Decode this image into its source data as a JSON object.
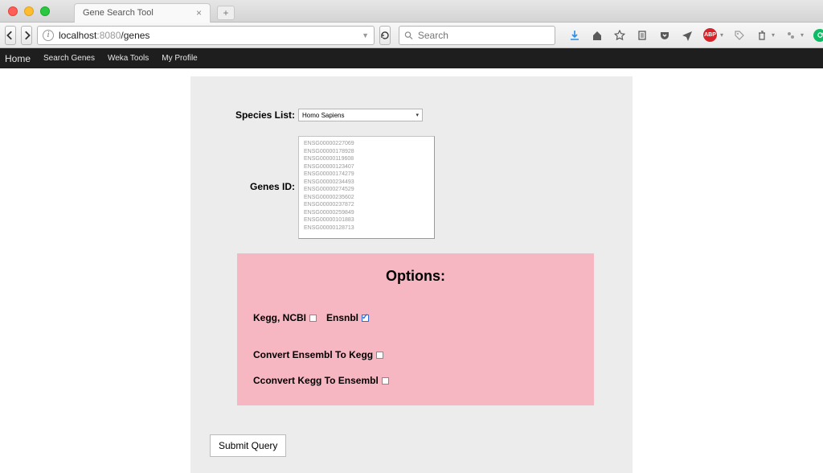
{
  "browser": {
    "tab_title": "Gene Search Tool",
    "url_host": "localhost",
    "url_port": ":8080",
    "url_path": "/genes",
    "search_placeholder": "Search",
    "abp_label": "ABP"
  },
  "nav": {
    "home": "Home",
    "search_genes": "Search Genes",
    "weka_tools": "Weka Tools",
    "my_profile": "My Profile"
  },
  "form": {
    "species_label": "Species List:",
    "species_value": "Homo Sapiens",
    "genes_label": "Genes ID:",
    "genes_value": "ENSG00000227069\nENSG00000178928\nENSG00000119608\nENSG00000123407\nENSG00000174279\nENSG00000234493\nENSG00000274529\nENSG00000235602\nENSG00000237872\nENSG00000259849\nENSG00000101883\nENSG00000128713"
  },
  "options": {
    "heading": "Options:",
    "kegg_ncbi": "Kegg, NCBI",
    "ensembl": "Ensnbl",
    "convert_e_to_k": "Convert Ensembl To Kegg",
    "convert_k_to_e": "Cconvert Kegg To Ensembl"
  },
  "submit_label": "Submit Query"
}
